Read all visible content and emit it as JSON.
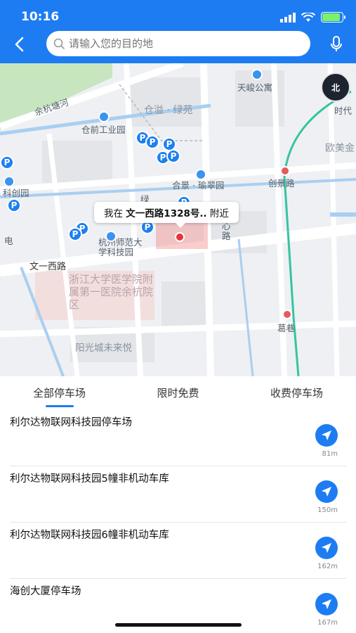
{
  "status": {
    "time": "10:16"
  },
  "header": {
    "search_placeholder": "请输入您的目的地",
    "back_icon": "back-arrow-icon",
    "mic_icon": "microphone-icon"
  },
  "map": {
    "callout_prefix": "我在 ",
    "callout_address": "文一西路1328号..",
    "callout_suffix": " 附近",
    "compass_label": "北",
    "labels": {
      "yuhang_river": "余杭塘河",
      "tianjun": "天峻公寓",
      "cangyi": "仓溢 · 绿苑",
      "time": "时代",
      "cangqian": "仓前工业园",
      "oumei": "欧美金",
      "hezhaoyuan": "合景 · 瑜翠园",
      "chuangjing": "创景路",
      "kechuang": "科创园",
      "dian": "电",
      "hangshida": "杭州师范大学科技园",
      "wenyi": "文一西路",
      "zheyi": "浙江大学医学院附属第一医院余杭院区",
      "gexiang": "葛巷",
      "yangguang": "阳光城未来悦",
      "lu": "绿",
      "xinlu": "心路",
      "hang": "杭"
    },
    "parking_symbol": "P"
  },
  "tabs": [
    {
      "label": "全部停车场",
      "active": true
    },
    {
      "label": "限时免费",
      "active": false
    },
    {
      "label": "收费停车场",
      "active": false
    }
  ],
  "parkings": [
    {
      "name": "利尔达物联网科技园停车场",
      "distance": "81m"
    },
    {
      "name": "利尔达物联网科技园5幢非机动车库",
      "distance": "150m"
    },
    {
      "name": "利尔达物联网科技园6幢非机动车库",
      "distance": "162m"
    },
    {
      "name": "海创大厦停车场",
      "distance": "167m"
    }
  ],
  "colors": {
    "brand": "#1e7cf2",
    "location_dot": "#e8333a"
  }
}
